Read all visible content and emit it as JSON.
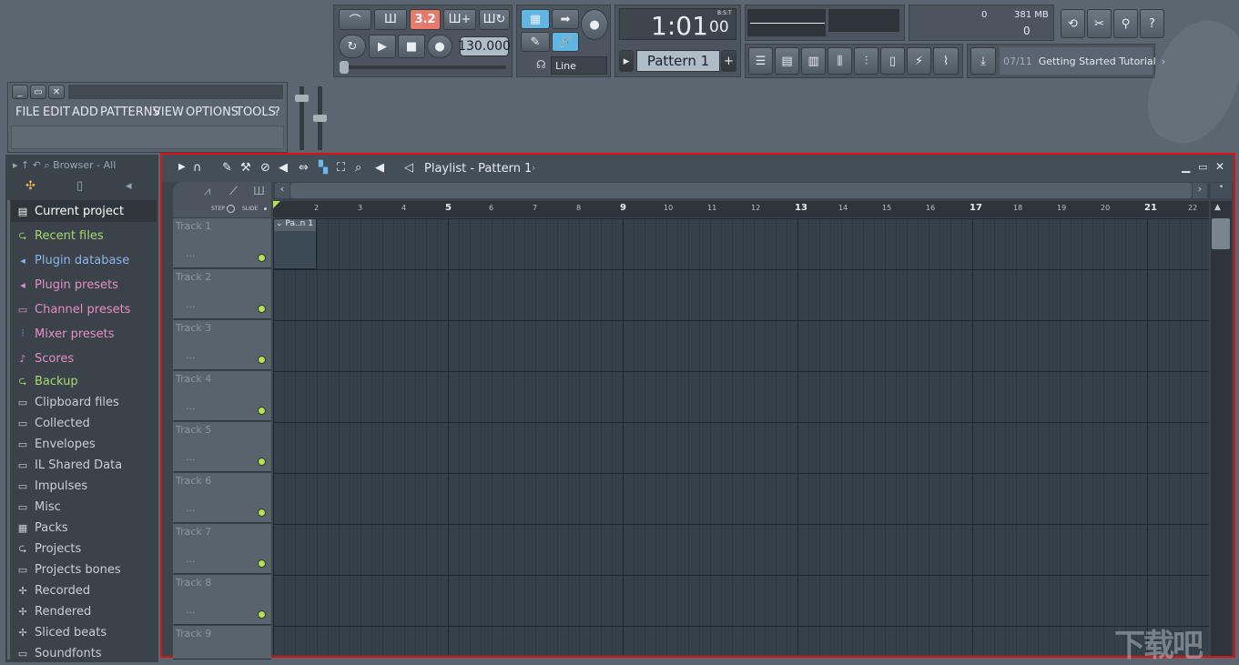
{
  "transport": {
    "tempo": "130.000",
    "pattern_indicator": "3.2",
    "time": "1:01",
    "time_sub": "00",
    "time_label": "B:S:T",
    "pattern_name": "Pattern 1",
    "snap": "Line"
  },
  "cpu": {
    "poly": "0",
    "memory": "381 MB",
    "voices": "0"
  },
  "hint": {
    "counter": "07/11",
    "text": "Getting Started Tutorial"
  },
  "menu": [
    "FILE",
    "EDIT",
    "ADD",
    "PATTERNS",
    "VIEW",
    "OPTIONS",
    "TOOLS",
    "?"
  ],
  "browser": {
    "title": "Browser - All",
    "items": [
      {
        "label": "Current project",
        "icon": "page-icon",
        "color": "#ffffff"
      },
      {
        "label": "Recent files",
        "icon": "folder-arrow-icon",
        "color": "#a8d86e"
      },
      {
        "label": "Plugin database",
        "icon": "plug-icon",
        "color": "#8eb4e8"
      },
      {
        "label": "Plugin presets",
        "icon": "plug-icon",
        "color": "#e78ec7"
      },
      {
        "label": "Channel presets",
        "icon": "channel-icon",
        "color": "#e78ec7"
      },
      {
        "label": "Mixer presets",
        "icon": "mixer-icon",
        "color": "#e78ec7"
      },
      {
        "label": "Scores",
        "icon": "note-icon",
        "color": "#e78ec7"
      },
      {
        "label": "Backup",
        "icon": "folder-arrow-icon",
        "color": "#a8d86e"
      },
      {
        "label": "Clipboard files",
        "icon": "folder-icon",
        "color": "#c8d0d6"
      },
      {
        "label": "Collected",
        "icon": "folder-icon",
        "color": "#c8d0d6"
      },
      {
        "label": "Envelopes",
        "icon": "folder-icon",
        "color": "#c8d0d6"
      },
      {
        "label": "IL Shared Data",
        "icon": "folder-icon",
        "color": "#c8d0d6"
      },
      {
        "label": "Impulses",
        "icon": "folder-icon",
        "color": "#c8d0d6"
      },
      {
        "label": "Misc",
        "icon": "folder-icon",
        "color": "#c8d0d6"
      },
      {
        "label": "Packs",
        "icon": "packs-icon",
        "color": "#c8d0d6"
      },
      {
        "label": "Projects",
        "icon": "folder-arrow-icon",
        "color": "#c8d0d6"
      },
      {
        "label": "Projects bones",
        "icon": "folder-icon",
        "color": "#c8d0d6"
      },
      {
        "label": "Recorded",
        "icon": "wave-icon",
        "color": "#c8d0d6"
      },
      {
        "label": "Rendered",
        "icon": "wave-icon",
        "color": "#c8d0d6"
      },
      {
        "label": "Sliced beats",
        "icon": "wave-icon",
        "color": "#c8d0d6"
      },
      {
        "label": "Soundfonts",
        "icon": "folder-icon",
        "color": "#c8d0d6"
      }
    ]
  },
  "playlist": {
    "title": "Playlist - Pattern 1",
    "step_label": "STEP",
    "slide_label": "SLIDE",
    "clip_label": "Pa..n 1",
    "tracks": [
      "Track 1",
      "Track 2",
      "Track 3",
      "Track 4",
      "Track 5",
      "Track 6",
      "Track 7",
      "Track 8",
      "Track 9"
    ],
    "track_dots": "...",
    "ruler": [
      "2",
      "3",
      "4",
      "5",
      "6",
      "7",
      "8",
      "9",
      "10",
      "11",
      "12",
      "13",
      "14",
      "15",
      "16",
      "17",
      "18",
      "19",
      "20",
      "21",
      "22"
    ],
    "ruler_bold": [
      "5",
      "9",
      "13",
      "17",
      "21"
    ]
  },
  "watermark": "下载吧"
}
